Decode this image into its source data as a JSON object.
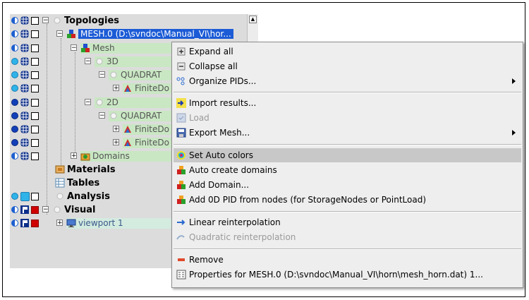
{
  "tree": {
    "items": [
      {
        "label": "Topologies",
        "icon": "circle-icon"
      },
      {
        "label": "MESH.0 (D:\\svndoc\\Manual_VI\\hor...",
        "icon": "mesh-icon"
      },
      {
        "label": "Mesh",
        "icon": "mesh-icon"
      },
      {
        "label": "3D",
        "icon": "circle-icon"
      },
      {
        "label": "QUADRAT",
        "icon": "circle-icon"
      },
      {
        "label": "FiniteDo",
        "icon": "element-icon"
      },
      {
        "label": "2D",
        "icon": "circle-icon"
      },
      {
        "label": "QUADRAT",
        "icon": "circle-icon"
      },
      {
        "label": "FiniteDo",
        "icon": "element-icon"
      },
      {
        "label": "FiniteDo",
        "icon": "element-icon"
      },
      {
        "label": "Domains",
        "icon": "domains-icon"
      },
      {
        "label": "Materials",
        "icon": "materials-icon"
      },
      {
        "label": "Tables",
        "icon": "tables-icon"
      },
      {
        "label": "Analysis",
        "icon": "circle-icon"
      },
      {
        "label": "Visual",
        "icon": "circle-icon"
      },
      {
        "label": "viewport 1",
        "icon": "viewport-icon"
      }
    ]
  },
  "menu": {
    "expand_all": "Expand all",
    "collapse_all": "Collapse all",
    "organize_pids": "Organize PIDs...",
    "import_results": "Import results...",
    "load": "Load",
    "export_mesh": "Export Mesh...",
    "set_auto_colors": "Set Auto colors",
    "auto_create_domains": "Auto create domains",
    "add_domain": "Add Domain...",
    "add_0d_pid": "Add 0D PID from nodes (for StorageNodes or PointLoad)",
    "linear_reinterpolation": "Linear reinterpolation",
    "quadratic_reinterpolation": "Quadratic reinterpolation",
    "remove": "Remove",
    "properties": "Properties for MESH.0 (D:\\svndoc\\Manual_VI\\horn\\mesh_horn.dat) 1..."
  },
  "colors": {
    "selection": "#1c5bd6",
    "highlight_green": "#c9e7c3",
    "menu_bg": "#eeeeee",
    "hover": "#c8c8c8"
  }
}
